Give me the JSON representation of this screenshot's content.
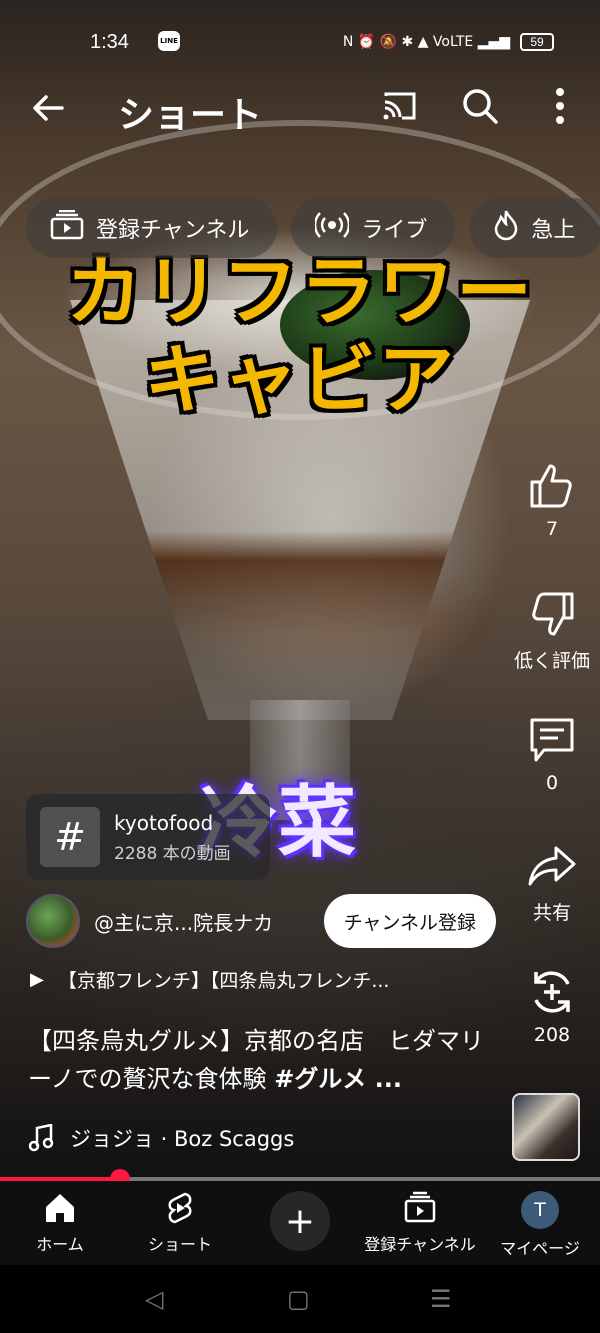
{
  "status_bar": {
    "time": "1:34",
    "line_icon": "LINE",
    "network_icons": "N ⏰ 🔕 ✱ ▲ VoLTE ▂▄▆",
    "battery": "59"
  },
  "app_bar": {
    "title": "ショート"
  },
  "chips": [
    {
      "label": "登録チャンネル",
      "icon": "subscriptions-icon"
    },
    {
      "label": "ライブ",
      "icon": "live-icon"
    },
    {
      "label": "急上",
      "icon": "trending-icon"
    }
  ],
  "video_overlay": {
    "title_line1": "カリフラワー",
    "title_line2": "キャビア",
    "subtitle": "冷菜"
  },
  "actions": {
    "like_count": "7",
    "dislike_label": "低く評価",
    "comment_count": "0",
    "share_label": "共有",
    "remix_count": "208"
  },
  "hashtag_card": {
    "symbol": "#",
    "tag": "kyotofood",
    "count": "2288 本の動画"
  },
  "channel": {
    "name": "@主に京...院長ナカ",
    "subscribe_label": "チャンネル登録"
  },
  "playlist": {
    "text": "【京都フレンチ】【四条烏丸フレンチ..."
  },
  "description": {
    "text": "【四条烏丸グルメ】京都の名店　ヒダマリーノでの贅沢な食体験 ",
    "hashtag": "#グルメ ..."
  },
  "music": {
    "text": "ジョジョ · Boz Scaggs"
  },
  "progress": {
    "fraction": 0.2
  },
  "bottom_nav": {
    "home": "ホーム",
    "shorts": "ショート",
    "add": "+",
    "subscriptions": "登録チャンネル",
    "you": "マイページ",
    "avatar_letter": "T"
  },
  "colors": {
    "accent_red": "#ff1744",
    "title_yellow": "#f5b800",
    "subtitle_purple": "#6a3cff"
  }
}
